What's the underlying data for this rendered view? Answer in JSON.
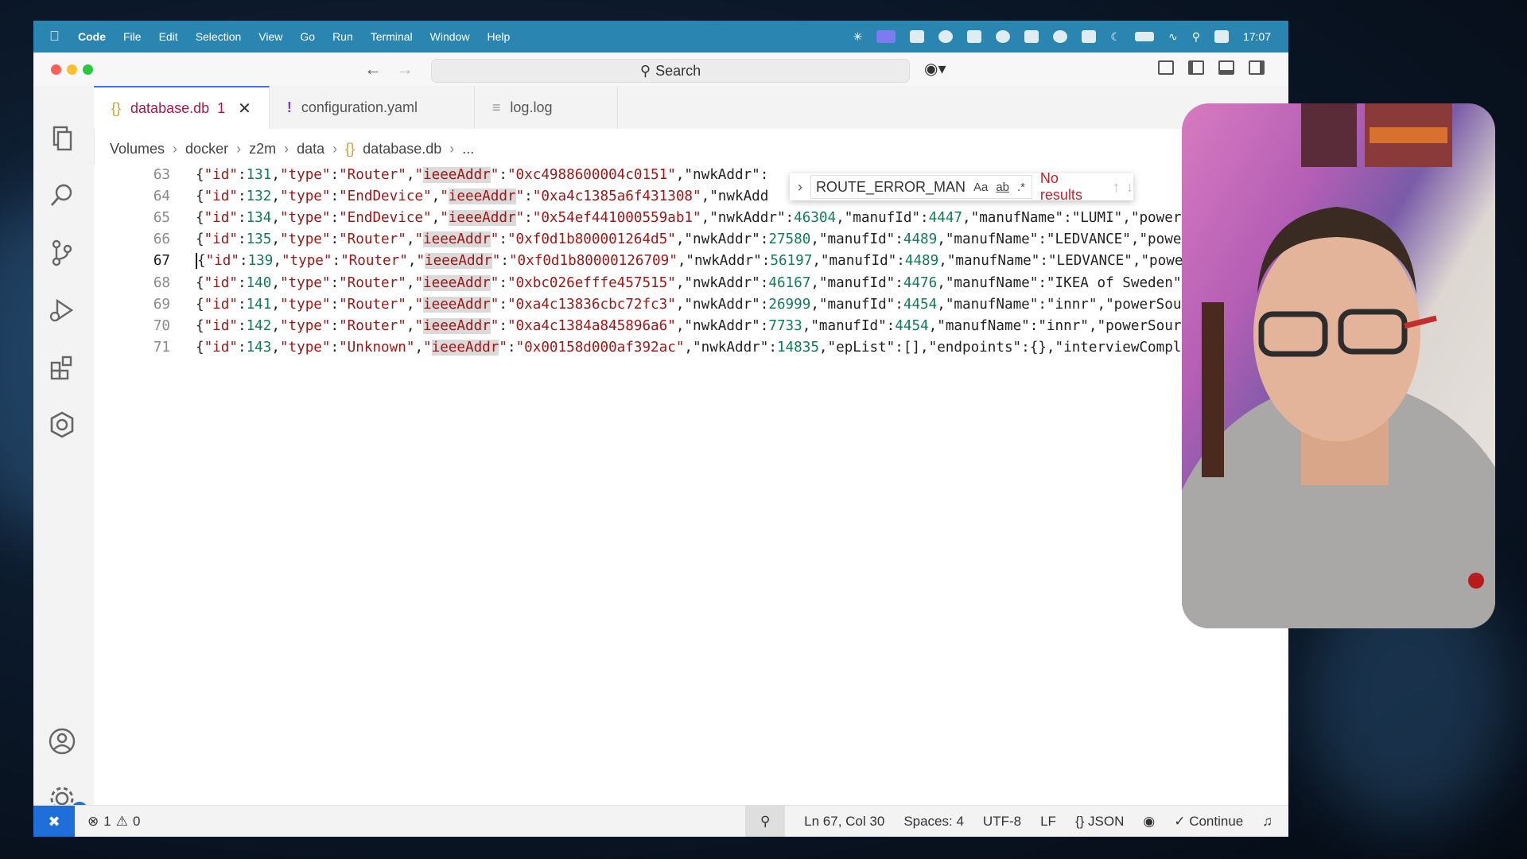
{
  "menubar": {
    "app_name": "Code",
    "items": [
      "File",
      "Edit",
      "Selection",
      "View",
      "Go",
      "Run",
      "Terminal",
      "Window",
      "Help"
    ],
    "clock": "17:07"
  },
  "titlebar": {
    "search_label": "Search"
  },
  "tabs": [
    {
      "label": "database.db",
      "glyph": "{}",
      "dirty_count": "1",
      "active": true
    },
    {
      "label": "configuration.yaml",
      "glyph": "!",
      "active": false
    },
    {
      "label": "log.log",
      "glyph": "≡",
      "active": false
    }
  ],
  "breadcrumb": [
    "Volumes",
    "docker",
    "z2m",
    "data",
    "database.db",
    "..."
  ],
  "find_widget": {
    "query": "ROUTE_ERROR_MAN",
    "options": [
      "Aa",
      "ab",
      ".*"
    ],
    "result": "No results"
  },
  "editor": {
    "lines": [
      {
        "num": "63",
        "id": "131",
        "type": "Router",
        "ieee": "0xc4988600004c0151",
        "rest": ",\"nwkAddr\":"
      },
      {
        "num": "64",
        "id": "132",
        "type": "EndDevice",
        "ieee": "0xa4c1385a6f431308",
        "rest": ",\"nwkAdd"
      },
      {
        "num": "65",
        "id": "134",
        "type": "EndDevice",
        "ieee": "0x54ef441000559ab1",
        "rest": ",\"nwkAddr\":46304,\"manufId\":4447,\"manufName\":\"LUMI\",\"power"
      },
      {
        "num": "66",
        "id": "135",
        "type": "Router",
        "ieee": "0xf0d1b800001264d5",
        "rest": ",\"nwkAddr\":27580,\"manufId\":4489,\"manufName\":\"LEDVANCE\",\"powe"
      },
      {
        "num": "67",
        "id": "139",
        "type": "Router",
        "ieee": "0xf0d1b80000126709",
        "rest": ",\"nwkAddr\":56197,\"manufId\":4489,\"manufName\":\"LEDVANCE\",\"powe"
      },
      {
        "num": "68",
        "id": "140",
        "type": "Router",
        "ieee": "0xbc026efffe457515",
        "rest": ",\"nwkAddr\":46167,\"manufId\":4476,\"manufName\":\"IKEA of Sweden\""
      },
      {
        "num": "69",
        "id": "141",
        "type": "Router",
        "ieee": "0xa4c13836cbc72fc3",
        "rest": ",\"nwkAddr\":26999,\"manufId\":4454,\"manufName\":\"innr\",\"powerSou"
      },
      {
        "num": "70",
        "id": "142",
        "type": "Router",
        "ieee": "0xa4c1384a845896a6",
        "rest": ",\"nwkAddr\":7733,\"manufId\":4454,\"manufName\":\"innr\",\"powerSour"
      },
      {
        "num": "71",
        "id": "143",
        "type": "Unknown",
        "ieee": "0x00158d000af392ac",
        "rest": ",\"nwkAddr\":14835,\"epList\":[],\"endpoints\":{},\"interviewCompl"
      }
    ],
    "current_line": "67"
  },
  "statusbar": {
    "errors": "1",
    "warnings": "0",
    "position": "Ln 67, Col 30",
    "spaces": "Spaces: 4",
    "encoding": "UTF-8",
    "eol": "LF",
    "language": "JSON",
    "continue": "Continue",
    "settings_badge": "1"
  },
  "colors": {
    "menubar_bg": "#2a86b0",
    "accent": "#1e6fd9",
    "active_tab_text": "#b3154a",
    "string": "#a31515",
    "number": "#0d7d58",
    "no_results": "#c81e2b"
  }
}
